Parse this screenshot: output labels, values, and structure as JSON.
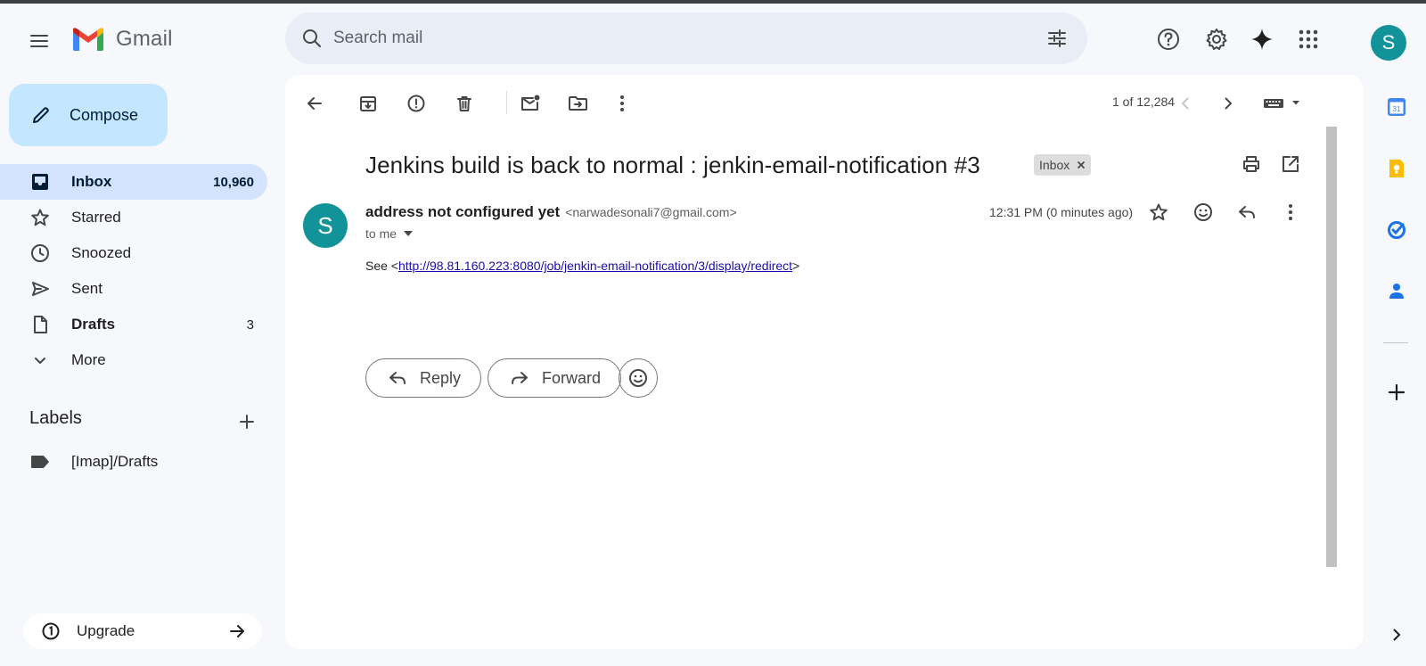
{
  "app": {
    "name": "Gmail"
  },
  "header": {
    "search_placeholder": "Search mail",
    "avatar_initial": "S"
  },
  "sidebar": {
    "compose_label": "Compose",
    "items": [
      {
        "label": "Inbox",
        "count": "10,960",
        "icon": "inbox-icon"
      },
      {
        "label": "Starred",
        "count": "",
        "icon": "star-icon"
      },
      {
        "label": "Snoozed",
        "count": "",
        "icon": "clock-icon"
      },
      {
        "label": "Sent",
        "count": "",
        "icon": "send-icon"
      },
      {
        "label": "Drafts",
        "count": "3",
        "icon": "draft-icon"
      },
      {
        "label": "More",
        "count": "",
        "icon": "chevron-down-icon"
      }
    ],
    "labels_title": "Labels",
    "labels": [
      {
        "label": "[Imap]/Drafts",
        "icon": "label-icon"
      }
    ],
    "upgrade_label": "Upgrade"
  },
  "toolbar": {
    "pager": "1 of 12,284"
  },
  "email": {
    "subject": "Jenkins build is back to normal : jenkin-email-notification #3",
    "chip": "Inbox",
    "sender_initial": "S",
    "sender_name": "address not configured yet",
    "sender_email": "<narwadesonali7@gmail.com>",
    "to": "to me",
    "time": "12:31 PM (0 minutes ago)",
    "body_prefix": "See <",
    "body_link": "http://98.81.160.223:8080/job/jenkin-email-notification/3/display/redirect",
    "body_suffix": ">",
    "reply_label": "Reply",
    "forward_label": "Forward"
  },
  "colors": {
    "accent": "#c2e7ff",
    "active_nav": "#d3e3fd",
    "avatar": "#12939a",
    "link": "#1a0dab"
  }
}
